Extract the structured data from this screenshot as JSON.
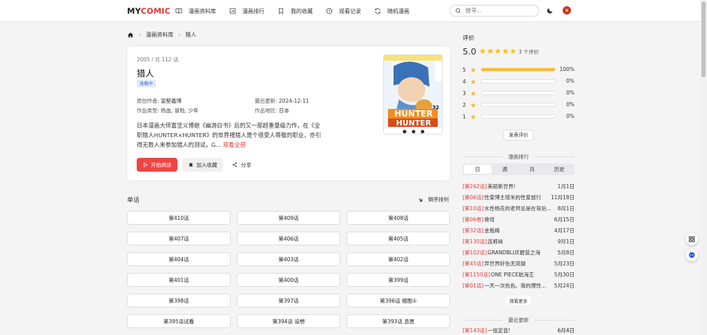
{
  "logo": {
    "part1": "MY",
    "part2": "COMIC"
  },
  "nav": [
    {
      "label": "漫画资料库",
      "icon": "book-open-icon"
    },
    {
      "label": "漫画排行",
      "icon": "chart-icon"
    },
    {
      "label": "我的收藏",
      "icon": "bookmark-icon"
    },
    {
      "label": "观看记录",
      "icon": "clock-icon"
    },
    {
      "label": "随机漫画",
      "icon": "refresh-icon"
    }
  ],
  "search": {
    "placeholder": "搜寻..."
  },
  "breadcrumb": {
    "level1": "漫画资料库",
    "level2": "猎人"
  },
  "comic": {
    "meta_top": "2005 / 共 112 话",
    "title": "猎人",
    "status": "连载中",
    "author_label": "原创作者:",
    "author": "富堅義博",
    "updated_label": "最后更新:",
    "updated": "2024-12-11",
    "genre_label": "作品类型:",
    "genre": "热血, 冒险, 少年",
    "region_label": "作品地区:",
    "region": "日本",
    "description": "日本漫画大师富坚义博继《幽游白书》后的又一部超重量级力作，在《全职猎人HUNTER×HUNTER》的世界裡猎人是个很受人尊敬的职业，亦引得无数人来参加猎人的测试，G...",
    "more": "观看全部",
    "read_label": "开始阅读",
    "fav_label": "加入收藏",
    "share_label": "分享",
    "cover_text_top": "HUNTER",
    "cover_text_bottom": "HUNTER",
    "cover_volume": "32"
  },
  "chapters": {
    "title": "单话",
    "sort_label": "倒序排列",
    "items": [
      "第410话",
      "第409话",
      "第408话",
      "第407话",
      "第406话",
      "第405话",
      "第404话",
      "第403话",
      "第402话",
      "第401话",
      "第400话",
      "第399话",
      "第398话",
      "第397话",
      "第396话 细图②",
      "第395话试看",
      "第394话 设想",
      "第393话 息愿"
    ]
  },
  "rating": {
    "title": "评价",
    "score": "5.0",
    "stars": 5,
    "count": "3 个评价",
    "rows": [
      {
        "n": "5",
        "fraction": 1.0,
        "pct": "100%"
      },
      {
        "n": "4",
        "fraction": 0,
        "pct": "0%"
      },
      {
        "n": "3",
        "fraction": 0,
        "pct": "0%"
      },
      {
        "n": "2",
        "fraction": 0,
        "pct": "0%"
      },
      {
        "n": "1",
        "fraction": 0,
        "pct": "0%"
      }
    ],
    "button": "发表评价"
  },
  "ranking": {
    "title": "漫画排行",
    "tabs": [
      "日",
      "週",
      "月",
      "历史"
    ],
    "items": [
      {
        "ep": "[第262话]",
        "name": "美丽新世界!",
        "date": "1月1日"
      },
      {
        "ep": "[第06话]",
        "name": "性爱博主塔米的性爱旅行",
        "date": "11月18日"
      },
      {
        "ep": "[第10话]",
        "name": "水性杨花的老师总是在背后偷看",
        "date": "8月1日"
      },
      {
        "ep": "[第06卷]",
        "name": "艳母",
        "date": "6月15日"
      },
      {
        "ep": "[第32话]",
        "name": "金瓶梅",
        "date": "4月17日"
      },
      {
        "ep": "[第130话]",
        "name": "连裤袜",
        "date": "9月1日"
      },
      {
        "ep": "[第102话]",
        "name": "GRANDBLUE碧蓝之海",
        "date": "5月8日"
      },
      {
        "ep": "[第45话]",
        "name": "异世界好色无双録",
        "date": "5月23日"
      },
      {
        "ep": "[第1150话]",
        "name": "ONE PIECE航海王",
        "date": "5月30日"
      },
      {
        "ep": "[第01话]",
        "name": "一天一次色色。我的理性要崩溃",
        "date": "5月24日"
      }
    ],
    "more": "观看更多"
  },
  "latest": {
    "title": "最近更新",
    "first": {
      "ep": "[第143话]",
      "name": "一弦定音!",
      "date": "6月4日"
    }
  }
}
